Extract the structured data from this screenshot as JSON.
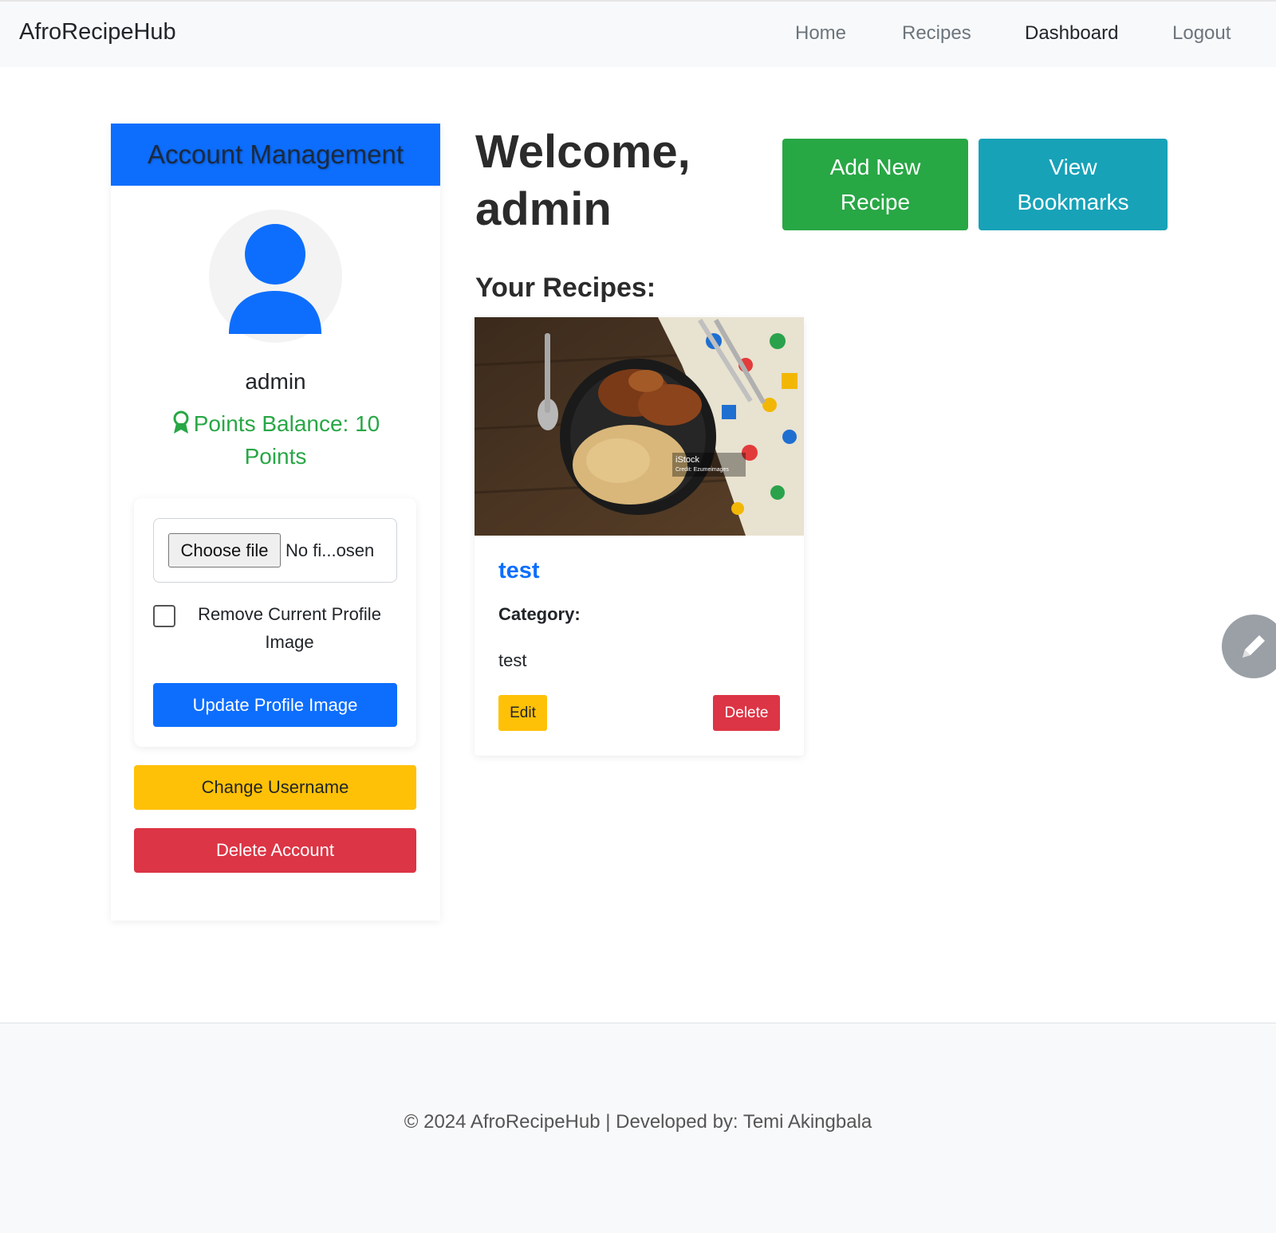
{
  "navbar": {
    "brand": "AfroRecipeHub",
    "links": [
      "Home",
      "Recipes",
      "Dashboard",
      "Logout"
    ],
    "active": "Dashboard"
  },
  "sidebar": {
    "header": "Account Management",
    "username": "admin",
    "points": "Points Balance: 10 Points",
    "file_button": "Choose file",
    "file_status": "No fi...osen",
    "remove_label": "Remove Current Profile Image",
    "remove_checked": false,
    "update_button": "Update Profile Image",
    "change_username_button": "Change Username",
    "delete_account_button": "Delete Account"
  },
  "main": {
    "welcome": "Welcome, admin",
    "add_recipe_button": "Add New Recipe",
    "view_bookmarks_button": "View Bookmarks",
    "section_title": "Your Recipes:",
    "recipes": [
      {
        "title": "test",
        "category_label": "Category:",
        "description": "test",
        "edit_label": "Edit",
        "delete_label": "Delete",
        "image_watermark": "iStock",
        "image_credit": "Credit: Ezumeimages"
      }
    ]
  },
  "footer": {
    "text": "© 2024 AfroRecipeHub | Developed by: Temi Akingbala"
  },
  "colors": {
    "primary": "#0d6efd",
    "success": "#28a745",
    "info": "#17a2b8",
    "warning": "#ffc107",
    "danger": "#dc3545"
  },
  "icons": [
    "user-avatar-icon",
    "award-icon",
    "pencil-icon"
  ]
}
